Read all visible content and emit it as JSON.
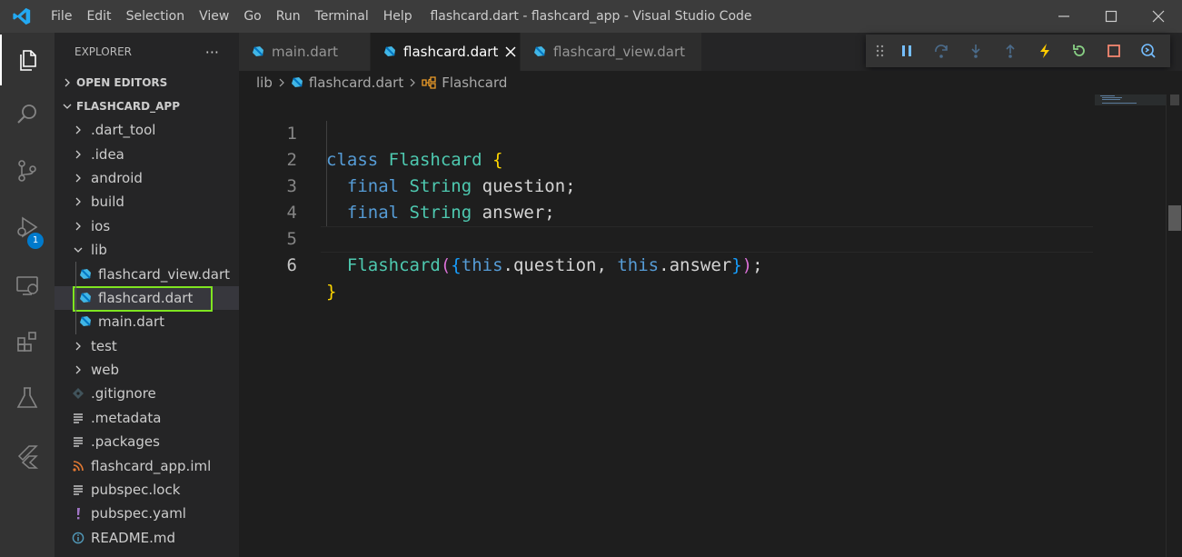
{
  "window": {
    "title": "flashcard.dart - flashcard_app - Visual Studio Code",
    "menu": [
      "File",
      "Edit",
      "Selection",
      "View",
      "Go",
      "Run",
      "Terminal",
      "Help"
    ]
  },
  "activity_bar": {
    "items": [
      {
        "name": "explorer",
        "icon": "files-icon"
      },
      {
        "name": "search",
        "icon": "search-icon"
      },
      {
        "name": "source-control",
        "icon": "source-control-icon"
      },
      {
        "name": "run-debug",
        "icon": "debug-icon",
        "badge": "1"
      },
      {
        "name": "remote-explorer",
        "icon": "remote-explorer-icon"
      },
      {
        "name": "extensions",
        "icon": "extensions-icon"
      },
      {
        "name": "testing",
        "icon": "flask-icon"
      },
      {
        "name": "flutter",
        "icon": "flutter-icon"
      }
    ]
  },
  "sidebar": {
    "title": "EXPLORER",
    "more": "···",
    "open_editors": "OPEN EDITORS",
    "project": "FLASHCARD_APP",
    "tree": [
      {
        "label": ".dart_tool",
        "kind": "folder"
      },
      {
        "label": ".idea",
        "kind": "folder"
      },
      {
        "label": "android",
        "kind": "folder"
      },
      {
        "label": "build",
        "kind": "folder"
      },
      {
        "label": "ios",
        "kind": "folder"
      },
      {
        "label": "lib",
        "kind": "folder-open"
      },
      {
        "label": "flashcard_view.dart",
        "kind": "dart"
      },
      {
        "label": "flashcard.dart",
        "kind": "dart",
        "selected": true
      },
      {
        "label": "main.dart",
        "kind": "dart"
      },
      {
        "label": "test",
        "kind": "folder"
      },
      {
        "label": "web",
        "kind": "folder"
      },
      {
        "label": ".gitignore",
        "kind": "git"
      },
      {
        "label": ".metadata",
        "kind": "lines"
      },
      {
        "label": ".packages",
        "kind": "lines"
      },
      {
        "label": "flashcard_app.iml",
        "kind": "rss"
      },
      {
        "label": "pubspec.lock",
        "kind": "lines"
      },
      {
        "label": "pubspec.yaml",
        "kind": "yaml"
      },
      {
        "label": "README.md",
        "kind": "info"
      }
    ]
  },
  "tabs": [
    {
      "label": "main.dart",
      "active": false
    },
    {
      "label": "flashcard.dart",
      "active": true
    },
    {
      "label": "flashcard_view.dart",
      "active": false
    }
  ],
  "breadcrumb": [
    "lib",
    "flashcard.dart",
    "Flashcard"
  ],
  "code": {
    "line_numbers": [
      "1",
      "2",
      "3",
      "4",
      "5",
      "6"
    ],
    "current_line": 6
  },
  "colors": {
    "accent": "#007acc",
    "selection_outline": "#7fe520",
    "keyword": "#569cd6",
    "type": "#4ec9b0"
  }
}
